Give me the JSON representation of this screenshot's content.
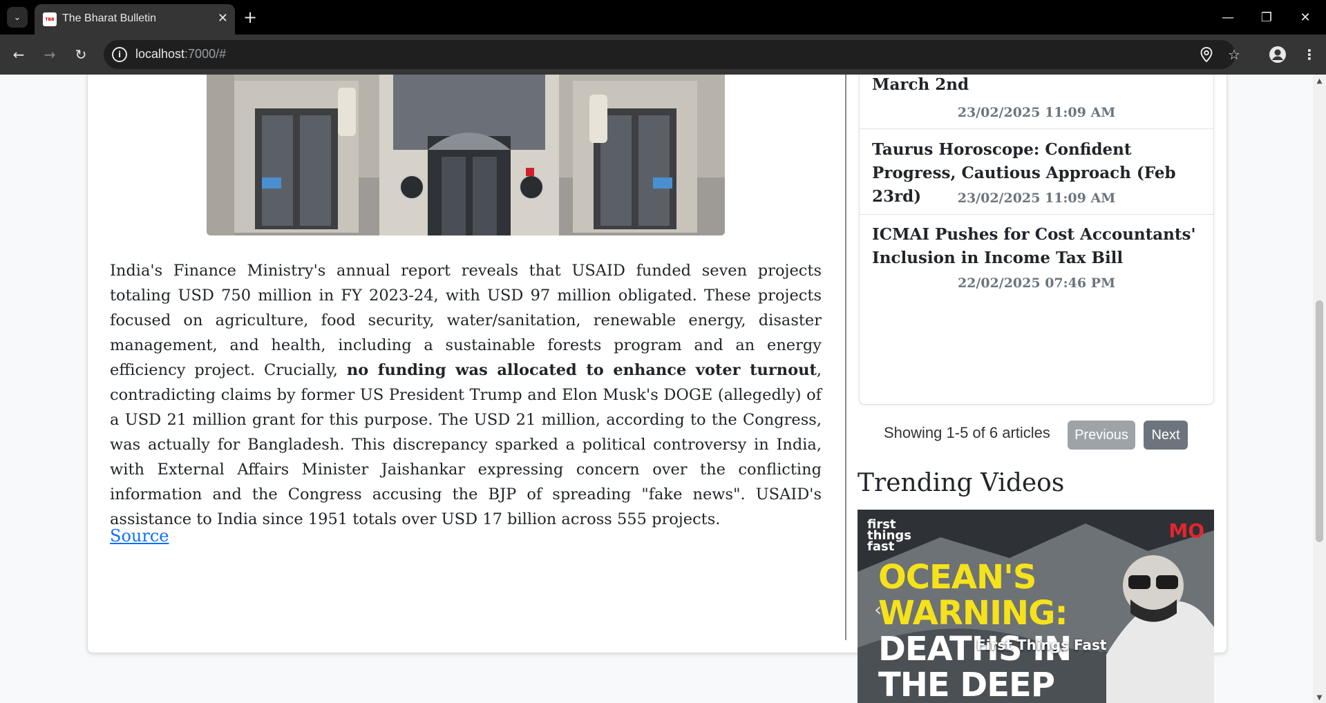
{
  "browser": {
    "tab_title": "The Bharat Bulletin",
    "favicon_text": "TBB",
    "url_host": "localhost",
    "url_rest": ":7000/#"
  },
  "article": {
    "image_alt": "Building entrance with revolving door",
    "body_intro": "India's Finance Ministry's annual report reveals that USAID funded seven projects totaling USD 750 million in FY 2023-24, with USD 97 million obligated. These projects focused on agriculture, food security, water/sanitation, renewable energy, disaster management, and health, including a sustainable forests program and an energy efficiency project. Crucially, ",
    "body_bold": "no funding was allocated to enhance voter turnout",
    "body_rest": ", contradicting claims by former US President Trump and Elon Musk's DOGE (allegedly) of a USD 21 million grant for this purpose. The USD 21 million, according to the Congress, was actually for Bangladesh. This discrepancy sparked a political controversy in India, with External Affairs Minister Jaishankar expressing concern over the conflicting information and the Congress accusing the BJP of spreading \"fake news\". USAID's assistance to India since 1951 totals over USD 17 billion across 555 projects.",
    "source_label": "Source"
  },
  "news_list": {
    "items": [
      {
        "title": "March 2nd",
        "date": "23/02/2025 11:09 AM"
      },
      {
        "title": "Taurus Horoscope: Confident Progress, Cautious Approach (Feb 23rd)",
        "date": "23/02/2025 11:09 AM"
      },
      {
        "title": "ICMAI Pushes for Cost Accountants' Inclusion in Income Tax Bill",
        "date": "22/02/2025 07:46 PM"
      }
    ]
  },
  "pagination": {
    "summary": "Showing 1-5 of 6 articles",
    "previous_label": "Previous",
    "next_label": "Next"
  },
  "videos": {
    "section_title": "Trending Videos",
    "thumb_logo": "first things fast",
    "thumb_brand": "MO",
    "thumb_line1": "OCEAN'S",
    "thumb_line2": "WARNING:",
    "thumb_line3": "DEATHS IN",
    "thumb_line4": "THE DEEP",
    "caption": "First Things Fast"
  }
}
